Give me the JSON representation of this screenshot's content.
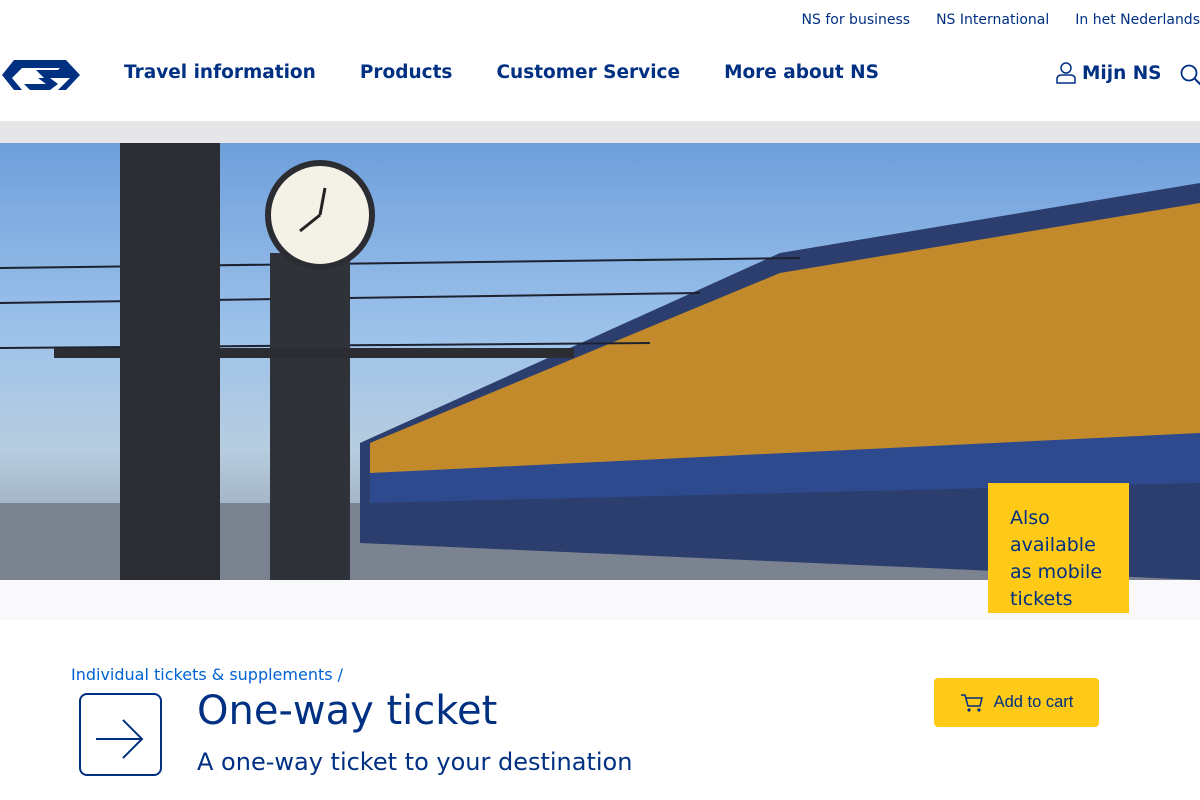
{
  "top_links": [
    "NS for business",
    "NS International",
    "In het Nederlands"
  ],
  "nav": [
    "Travel information",
    "Products",
    "Customer Service",
    "More about NS"
  ],
  "account": {
    "label": "Mijn NS",
    "icon": "user-icon"
  },
  "search_icon": "search-icon",
  "promo": "Also available as mobile tickets",
  "breadcrumb": "Individual tickets & supplements /",
  "title": "One-way ticket",
  "subtitle": "A one-way ticket to your destination",
  "cart": {
    "label": "Add to cart",
    "icon": "cart-icon"
  },
  "colors": {
    "brand_blue": "#003082",
    "yellow": "#ffc917",
    "link": "#0063d3"
  }
}
